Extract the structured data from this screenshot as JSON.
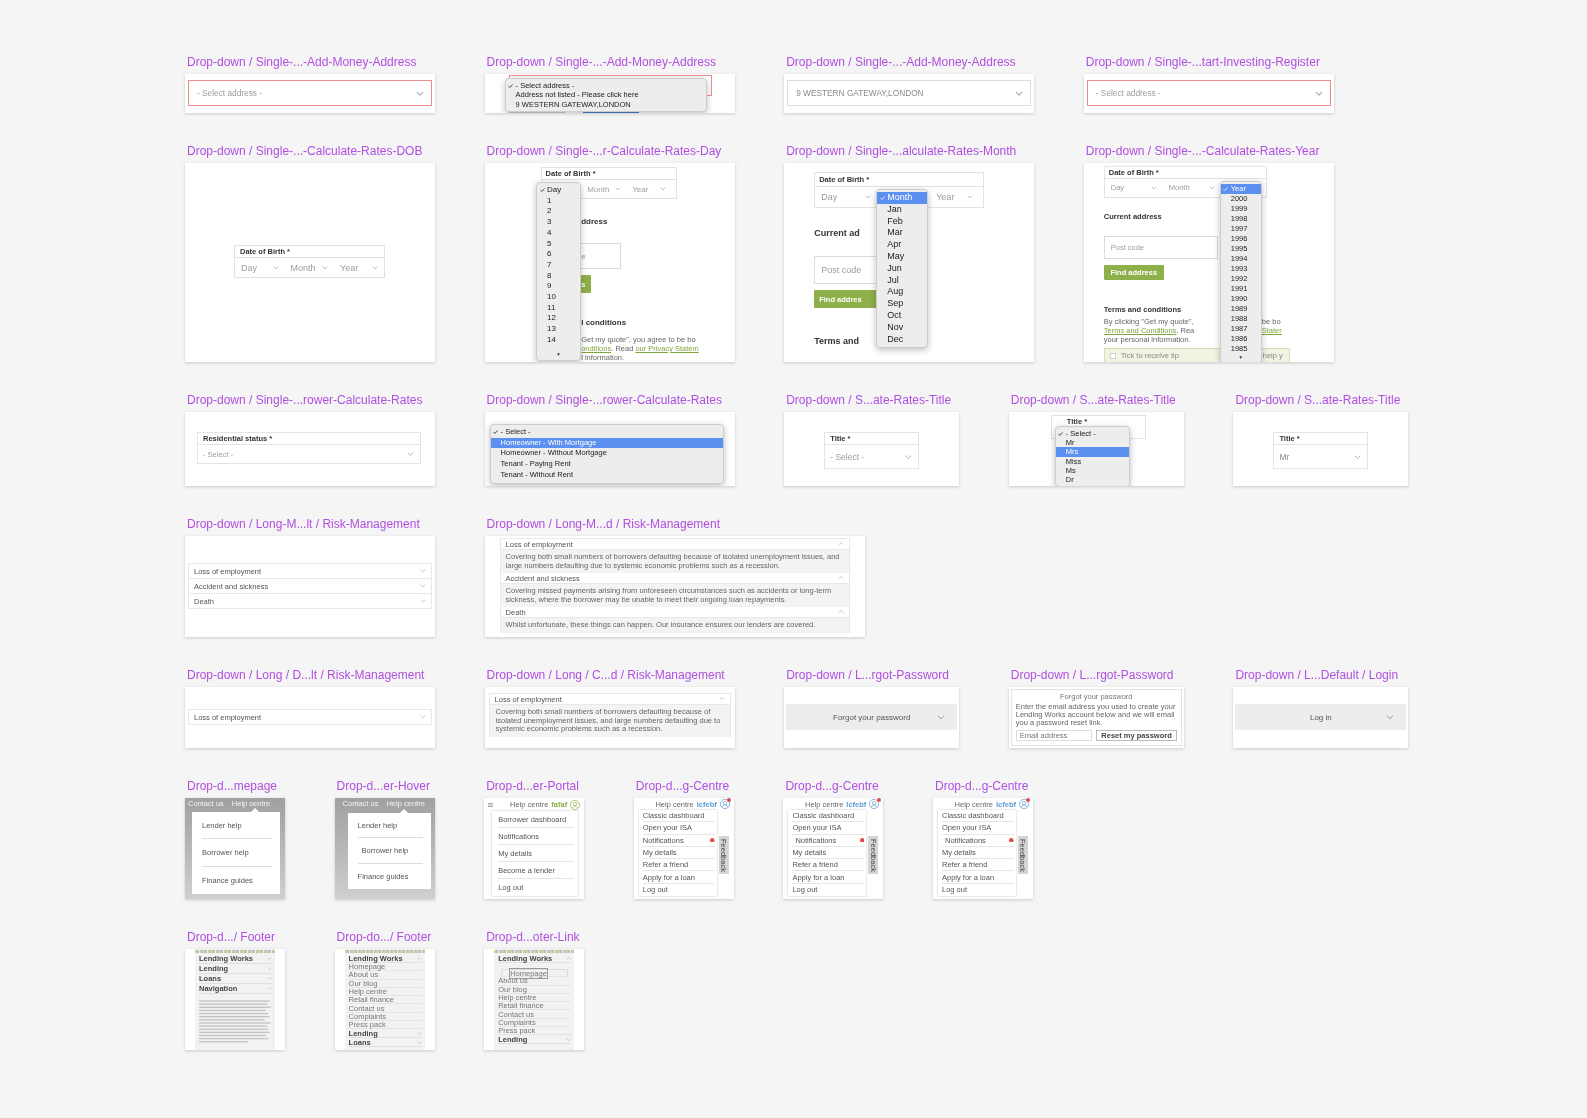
{
  "rows": [
    {
      "frames": [
        {
          "title": "Drop-down / Single-...-Add-Money-Address",
          "kind": "select",
          "placeholder": "- Select address -",
          "error": true
        },
        {
          "title": "Drop-down / Single-...-Add-Money-Address",
          "kind": "select-menu",
          "error": true,
          "options": [
            {
              "text": "- Select address -",
              "checked": true,
              "highlighted": false
            },
            {
              "text": "Address not listed - Please click here",
              "checked": false,
              "highlighted": false
            },
            {
              "text": "9 WESTERN GATEWAY,LONDON",
              "checked": false,
              "highlighted": false
            }
          ]
        },
        {
          "title": "Drop-down / Single-...-Add-Money-Address",
          "kind": "select",
          "value": "9 WESTERN GATEWAY,LONDON",
          "error": false
        },
        {
          "title": "Drop-down / Single-...tart-Investing-Register",
          "kind": "select",
          "placeholder": "- Select address -",
          "error": true
        }
      ]
    },
    {
      "frames": [
        {
          "title": "Drop-down / Single-...-Calculate-Rates-DOB",
          "kind": "date",
          "label": "Date of Birth *",
          "fields": [
            "Day",
            "Month",
            "Year"
          ]
        },
        {
          "title": "Drop-down / Single-...r-Calculate-Rates-Day",
          "kind": "date-menu",
          "label": "Date of Birth *",
          "form": [
            {
              "kind": "date-fields",
              "right": [
                "Month",
                "Year"
              ]
            },
            {
              "kind": "heading",
              "right": "ddress"
            },
            {
              "kind": "field",
              "right": "e"
            },
            {
              "kind": "button",
              "right": "s"
            },
            {
              "kind": "heading",
              "right": "l conditions"
            },
            {
              "kind": "text",
              "right": [
                {
                  "kind": "plain",
                  "text": "Get my quote\", you agree to be bo"
                }
              ]
            },
            {
              "kind": "text",
              "right": [
                {
                  "kind": "link",
                  "text": "onditions"
                },
                {
                  "kind": "plain",
                  "text": ". Read "
                },
                {
                  "kind": "link",
                  "text": "our Privacy Statem"
                }
              ]
            },
            {
              "kind": "text",
              "right": [
                {
                  "kind": "plain",
                  "text": "l information."
                }
              ]
            }
          ],
          "options": [
            {
              "text": "Day",
              "checked": true,
              "highlighted": false
            },
            {
              "text": "1",
              "checked": false,
              "highlighted": false
            },
            {
              "text": "2",
              "checked": false,
              "highlighted": false
            },
            {
              "text": "3",
              "checked": false,
              "highlighted": false
            },
            {
              "text": "4",
              "checked": false,
              "highlighted": false
            },
            {
              "text": "5",
              "checked": false,
              "highlighted": false
            },
            {
              "text": "6",
              "checked": false,
              "highlighted": false
            },
            {
              "text": "7",
              "checked": false,
              "highlighted": false
            },
            {
              "text": "8",
              "checked": false,
              "highlighted": false
            },
            {
              "text": "9",
              "checked": false,
              "highlighted": false
            },
            {
              "text": "10",
              "checked": false,
              "highlighted": false
            },
            {
              "text": "11",
              "checked": false,
              "highlighted": false
            },
            {
              "text": "12",
              "checked": false,
              "highlighted": false
            },
            {
              "text": "13",
              "checked": false,
              "highlighted": false
            },
            {
              "text": "14",
              "checked": false,
              "highlighted": false
            }
          ],
          "scroll_arrow": "▼"
        },
        {
          "title": "Drop-down / Single-...alculate-Rates-Month",
          "kind": "date-menu",
          "label": "Date of Birth *",
          "form": [
            {
              "kind": "date-fields",
              "left": [
                "Day"
              ],
              "right": [
                "Year"
              ]
            },
            {
              "kind": "heading",
              "left": "Current ad"
            },
            {
              "kind": "field",
              "left": "Post code"
            },
            {
              "kind": "button",
              "left": "Find addres"
            },
            {
              "kind": "heading",
              "left": "Terms and"
            }
          ],
          "options": [
            {
              "text": "Month",
              "checked": true,
              "highlighted": true
            },
            {
              "text": "Jan",
              "checked": false,
              "highlighted": false
            },
            {
              "text": "Feb",
              "checked": false,
              "highlighted": false
            },
            {
              "text": "Mar",
              "checked": false,
              "highlighted": false
            },
            {
              "text": "Apr",
              "checked": false,
              "highlighted": false
            },
            {
              "text": "May",
              "checked": false,
              "highlighted": false
            },
            {
              "text": "Jun",
              "checked": false,
              "highlighted": false
            },
            {
              "text": "Jul",
              "checked": false,
              "highlighted": false
            },
            {
              "text": "Aug",
              "checked": false,
              "highlighted": false
            },
            {
              "text": "Sep",
              "checked": false,
              "highlighted": false
            },
            {
              "text": "Oct",
              "checked": false,
              "highlighted": false
            },
            {
              "text": "Nov",
              "checked": false,
              "highlighted": false
            },
            {
              "text": "Dec",
              "checked": false,
              "highlighted": false
            }
          ]
        },
        {
          "title": "Drop-down / Single-...-Calculate-Rates-Year",
          "kind": "date-menu",
          "label": "Date of Birth *",
          "form": [
            {
              "kind": "date-fields",
              "left": [
                "Day",
                "Month"
              ]
            },
            {
              "kind": "heading",
              "left": "Current address"
            },
            {
              "kind": "field",
              "left": "Post code"
            },
            {
              "kind": "button",
              "left": "Find address"
            },
            {
              "kind": "heading",
              "left": "Terms and conditions"
            },
            {
              "kind": "text",
              "left": [
                {
                  "kind": "plain",
                  "text": "By clicking \"Get my quote\","
                }
              ],
              "right": [
                {
                  "kind": "plain",
                  "text": "be bo"
                }
              ]
            },
            {
              "kind": "text",
              "left": [
                {
                  "kind": "link",
                  "text": "Terms and Conditions"
                },
                {
                  "kind": "plain",
                  "text": ". Rea"
                }
              ],
              "right": [
                {
                  "kind": "link",
                  "text": "Stater"
                }
              ]
            },
            {
              "kind": "text",
              "left": [
                {
                  "kind": "plain",
                  "text": "your personal information."
                }
              ]
            },
            {
              "kind": "notice",
              "checked": false,
              "left": "Tick to receive tip",
              "right": "help y"
            }
          ],
          "options": [
            {
              "text": "Year",
              "checked": true,
              "highlighted": true
            },
            {
              "text": "2000",
              "checked": false,
              "highlighted": false
            },
            {
              "text": "1999",
              "checked": false,
              "highlighted": false
            },
            {
              "text": "1998",
              "checked": false,
              "highlighted": false
            },
            {
              "text": "1997",
              "checked": false,
              "highlighted": false
            },
            {
              "text": "1996",
              "checked": false,
              "highlighted": false
            },
            {
              "text": "1995",
              "checked": false,
              "highlighted": false
            },
            {
              "text": "1994",
              "checked": false,
              "highlighted": false
            },
            {
              "text": "1993",
              "checked": false,
              "highlighted": false
            },
            {
              "text": "1992",
              "checked": false,
              "highlighted": false
            },
            {
              "text": "1991",
              "checked": false,
              "highlighted": false
            },
            {
              "text": "1990",
              "checked": false,
              "highlighted": false
            },
            {
              "text": "1989",
              "checked": false,
              "highlighted": false
            },
            {
              "text": "1988",
              "checked": false,
              "highlighted": false
            },
            {
              "text": "1987",
              "checked": false,
              "highlighted": false
            },
            {
              "text": "1986",
              "checked": false,
              "highlighted": false
            },
            {
              "text": "1985",
              "checked": false,
              "highlighted": false
            }
          ],
          "scroll_arrow": "▼"
        }
      ]
    },
    {
      "frames": [
        {
          "title": "Drop-down / Single-...rower-Calculate-Rates",
          "kind": "labelled-select",
          "label": "Residential status *",
          "placeholder": "- Select -"
        },
        {
          "title": "Drop-down / Single-...rower-Calculate-Rates",
          "kind": "select-list",
          "options": [
            {
              "text": "- Select -",
              "checked": true,
              "highlighted": false
            },
            {
              "text": "Homeowner - With Mortgage",
              "checked": false,
              "highlighted": true
            },
            {
              "text": "Homeowner - Without Mortgage",
              "checked": false,
              "highlighted": false
            },
            {
              "text": "Tenant - Paying Rent",
              "checked": false,
              "highlighted": false
            },
            {
              "text": "Tenant - Without Rent",
              "checked": false,
              "highlighted": false
            }
          ]
        },
        {
          "title": "Drop-down / S...ate-Rates-Title",
          "kind": "labelled-select",
          "label": "Title *",
          "placeholder": "- Select -"
        },
        {
          "title": "Drop-down / S...ate-Rates-Title",
          "kind": "labelled-select-menu",
          "label": "Title *",
          "options": [
            {
              "text": "- Select -",
              "checked": true,
              "highlighted": false
            },
            {
              "text": "Mr",
              "checked": false,
              "highlighted": false
            },
            {
              "text": "Mrs",
              "checked": false,
              "highlighted": true
            },
            {
              "text": "Miss",
              "checked": false,
              "highlighted": false
            },
            {
              "text": "Ms",
              "checked": false,
              "highlighted": false
            },
            {
              "text": "Dr",
              "checked": false,
              "highlighted": false
            }
          ]
        },
        {
          "title": "Drop-down / S...ate-Rates-Title",
          "kind": "labelled-select",
          "label": "Title *",
          "value": "Mr"
        }
      ]
    },
    {
      "frames": [
        {
          "title": "Drop-down / Long-M...lt / Risk-Management",
          "kind": "accordion",
          "items": [
            {
              "title": "Loss of employment",
              "expanded": false
            },
            {
              "title": "Accident and sickness",
              "expanded": false
            },
            {
              "title": "Death",
              "expanded": false
            }
          ]
        },
        {
          "title": "Drop-down / Long-M...d / Risk-Management",
          "kind": "accordion",
          "items": [
            {
              "title": "Loss of employment",
              "expanded": true,
              "body": "Covering both small numbers of borrowers defaulting because of isolated unemployment issues, and large numbers defaulting due to systemic economic problems such as a recession."
            },
            {
              "title": "Accident and sickness",
              "expanded": true,
              "body": "Covering missed payments arising from unforeseen circumstances such as accidents or long-term sickness, where the borrower may be unable to meet their ongoing loan repayments."
            },
            {
              "title": "Death",
              "expanded": true,
              "body": "Whilst unfortunate, these things can happen. Our insurance ensures our lenders are covered."
            }
          ]
        }
      ]
    },
    {
      "frames": [
        {
          "title": "Drop-down / Long / D...lt / Risk-Management",
          "kind": "accordion",
          "items": [
            {
              "title": "Loss of employment",
              "expanded": false
            }
          ]
        },
        {
          "title": "Drop-down / Long / C...d / Risk-Management",
          "kind": "accordion",
          "items": [
            {
              "title": "Loss of employment",
              "expanded": true,
              "body": "Covering both small numbers of borrowers defaulting because of isolated unemployment issues, and large numbers defaulting due to systemic economic problems such as a recession."
            }
          ]
        },
        {
          "title": "Drop-down / L...rgot-Password",
          "kind": "toggle-bar",
          "label": "Forgot your password",
          "expanded": false
        },
        {
          "title": "Drop-down / L...rgot-Password",
          "kind": "forgot-panel",
          "heading": "Forgot your password",
          "text": "Enter the email address you used to create your Lending Works account below and we will email you a password reset link.",
          "placeholder": "Email address",
          "button": "Reset my password"
        },
        {
          "title": "Drop-down / L...Default / Login",
          "kind": "toggle-bar",
          "label": "Log in",
          "expanded": false
        }
      ]
    },
    {
      "frames": [
        {
          "title": "Drop-d...mepage",
          "kind": "nav-menu",
          "links": [
            "Contact us",
            "Help centre"
          ],
          "items": [
            {
              "text": "Lender help",
              "hovered": false
            },
            {
              "text": "Borrower help",
              "hovered": false
            },
            {
              "text": "Finance guides",
              "hovered": false
            }
          ]
        },
        {
          "title": "Drop-d...er-Hover",
          "kind": "nav-menu",
          "links": [
            "Contact us",
            "Help centre"
          ],
          "items": [
            {
              "text": "Lender help",
              "hovered": false
            },
            {
              "text": "Borrower help",
              "hovered": true
            },
            {
              "text": "Finance guides",
              "hovered": false
            }
          ]
        },
        {
          "title": "Drop-d...er-Portal",
          "kind": "account-menu",
          "menu_button": true,
          "link": "Help centre",
          "user": {
            "text": "fafaf",
            "color": "#8db04a"
          },
          "badge": false,
          "items": [
            {
              "text": "Borrower dashboard",
              "badge": false,
              "hovered": false
            },
            {
              "text": "Notifications",
              "badge": false,
              "hovered": false
            },
            {
              "text": "My details",
              "badge": false,
              "hovered": false
            },
            {
              "text": "Become a lender",
              "badge": false,
              "hovered": false
            },
            {
              "text": "Log out",
              "badge": false,
              "hovered": false
            }
          ]
        },
        {
          "title": "Drop-d...g-Centre",
          "kind": "account-menu",
          "menu_button": false,
          "link": "Help centre",
          "user": {
            "text": "lcfebf",
            "color": "#5b9bd5"
          },
          "badge": true,
          "items": [
            {
              "text": "Classic dashboard",
              "badge": false,
              "hovered": false
            },
            {
              "text": "Open your ISA",
              "badge": false,
              "hovered": false
            },
            {
              "text": "Notifications",
              "badge": true,
              "hovered": false
            },
            {
              "text": "My details",
              "badge": false,
              "hovered": false
            },
            {
              "text": "Refer a friend",
              "badge": false,
              "hovered": false
            },
            {
              "text": "Apply for a loan",
              "badge": false,
              "hovered": false
            },
            {
              "text": "Log out",
              "badge": false,
              "hovered": false
            }
          ],
          "feedback": "Feedback"
        },
        {
          "title": "Drop-d...g-Centre",
          "kind": "account-menu",
          "menu_button": false,
          "link": "Help centre",
          "user": {
            "text": "lcfebf",
            "color": "#5b9bd5"
          },
          "badge": true,
          "items": [
            {
              "text": "Classic dashboard",
              "badge": false,
              "hovered": false
            },
            {
              "text": "Open your ISA",
              "badge": false,
              "hovered": false
            },
            {
              "text": "Notifications",
              "badge": true,
              "hovered": true
            },
            {
              "text": "My details",
              "badge": false,
              "hovered": false
            },
            {
              "text": "Refer a friend",
              "badge": false,
              "hovered": false
            },
            {
              "text": "Apply for a loan",
              "badge": false,
              "hovered": false
            },
            {
              "text": "Log out",
              "badge": false,
              "hovered": false
            }
          ],
          "feedback": "Feedback"
        },
        {
          "title": "Drop-d...g-Centre",
          "kind": "account-menu",
          "menu_button": false,
          "link": "Help centre",
          "user": {
            "text": "lcfebf",
            "color": "#5b9bd5"
          },
          "badge": true,
          "items": [
            {
              "text": "Classic dashboard",
              "badge": false,
              "hovered": false
            },
            {
              "text": "Open your ISA",
              "badge": false,
              "hovered": false
            },
            {
              "text": "Notifications",
              "badge": true,
              "hovered": true
            },
            {
              "text": "My details",
              "badge": false,
              "hovered": false
            },
            {
              "text": "Refer a friend",
              "badge": false,
              "hovered": false
            },
            {
              "text": "Apply for a loan",
              "badge": false,
              "hovered": false
            },
            {
              "text": "Log out",
              "badge": false,
              "hovered": false
            }
          ],
          "feedback": "Feedback"
        }
      ]
    },
    {
      "frames": [
        {
          "title": "Drop-d.../ Footer",
          "kind": "footer",
          "sections": [
            {
              "title": "Lending Works",
              "expanded": false
            },
            {
              "title": "Lending",
              "expanded": false
            },
            {
              "title": "Loans",
              "expanded": false
            },
            {
              "title": "Navigation",
              "expanded": false
            }
          ],
          "fine_print": true
        },
        {
          "title": "Drop-do.../ Footer",
          "kind": "footer",
          "sections": [
            {
              "title": "Lending Works",
              "expanded": true,
              "links": [
                {
                  "text": "Homepage",
                  "selected": false
                },
                {
                  "text": "About us",
                  "selected": false
                },
                {
                  "text": "Our blog",
                  "selected": false
                },
                {
                  "text": "Help centre",
                  "selected": false
                },
                {
                  "text": "Retail finance",
                  "selected": false
                },
                {
                  "text": "Contact us",
                  "selected": false
                },
                {
                  "text": "Complaints",
                  "selected": false
                },
                {
                  "text": "Press pack",
                  "selected": false
                }
              ]
            },
            {
              "title": "Lending",
              "expanded": false
            },
            {
              "title": "Loans",
              "expanded": false
            }
          ]
        },
        {
          "title": "Drop-d...oter-Link",
          "kind": "footer",
          "sections": [
            {
              "title": "Lending Works",
              "expanded": true,
              "links": [
                {
                  "text": "Homepage",
                  "selected": true
                },
                {
                  "text": "About us",
                  "selected": false
                },
                {
                  "text": "Our blog",
                  "selected": false
                },
                {
                  "text": "Help centre",
                  "selected": false
                },
                {
                  "text": "Retail finance",
                  "selected": false
                },
                {
                  "text": "Contact us",
                  "selected": false
                },
                {
                  "text": "Complaints",
                  "selected": false
                },
                {
                  "text": "Press pack",
                  "selected": false
                }
              ]
            },
            {
              "title": "Lending",
              "expanded": false
            }
          ]
        }
      ]
    }
  ]
}
